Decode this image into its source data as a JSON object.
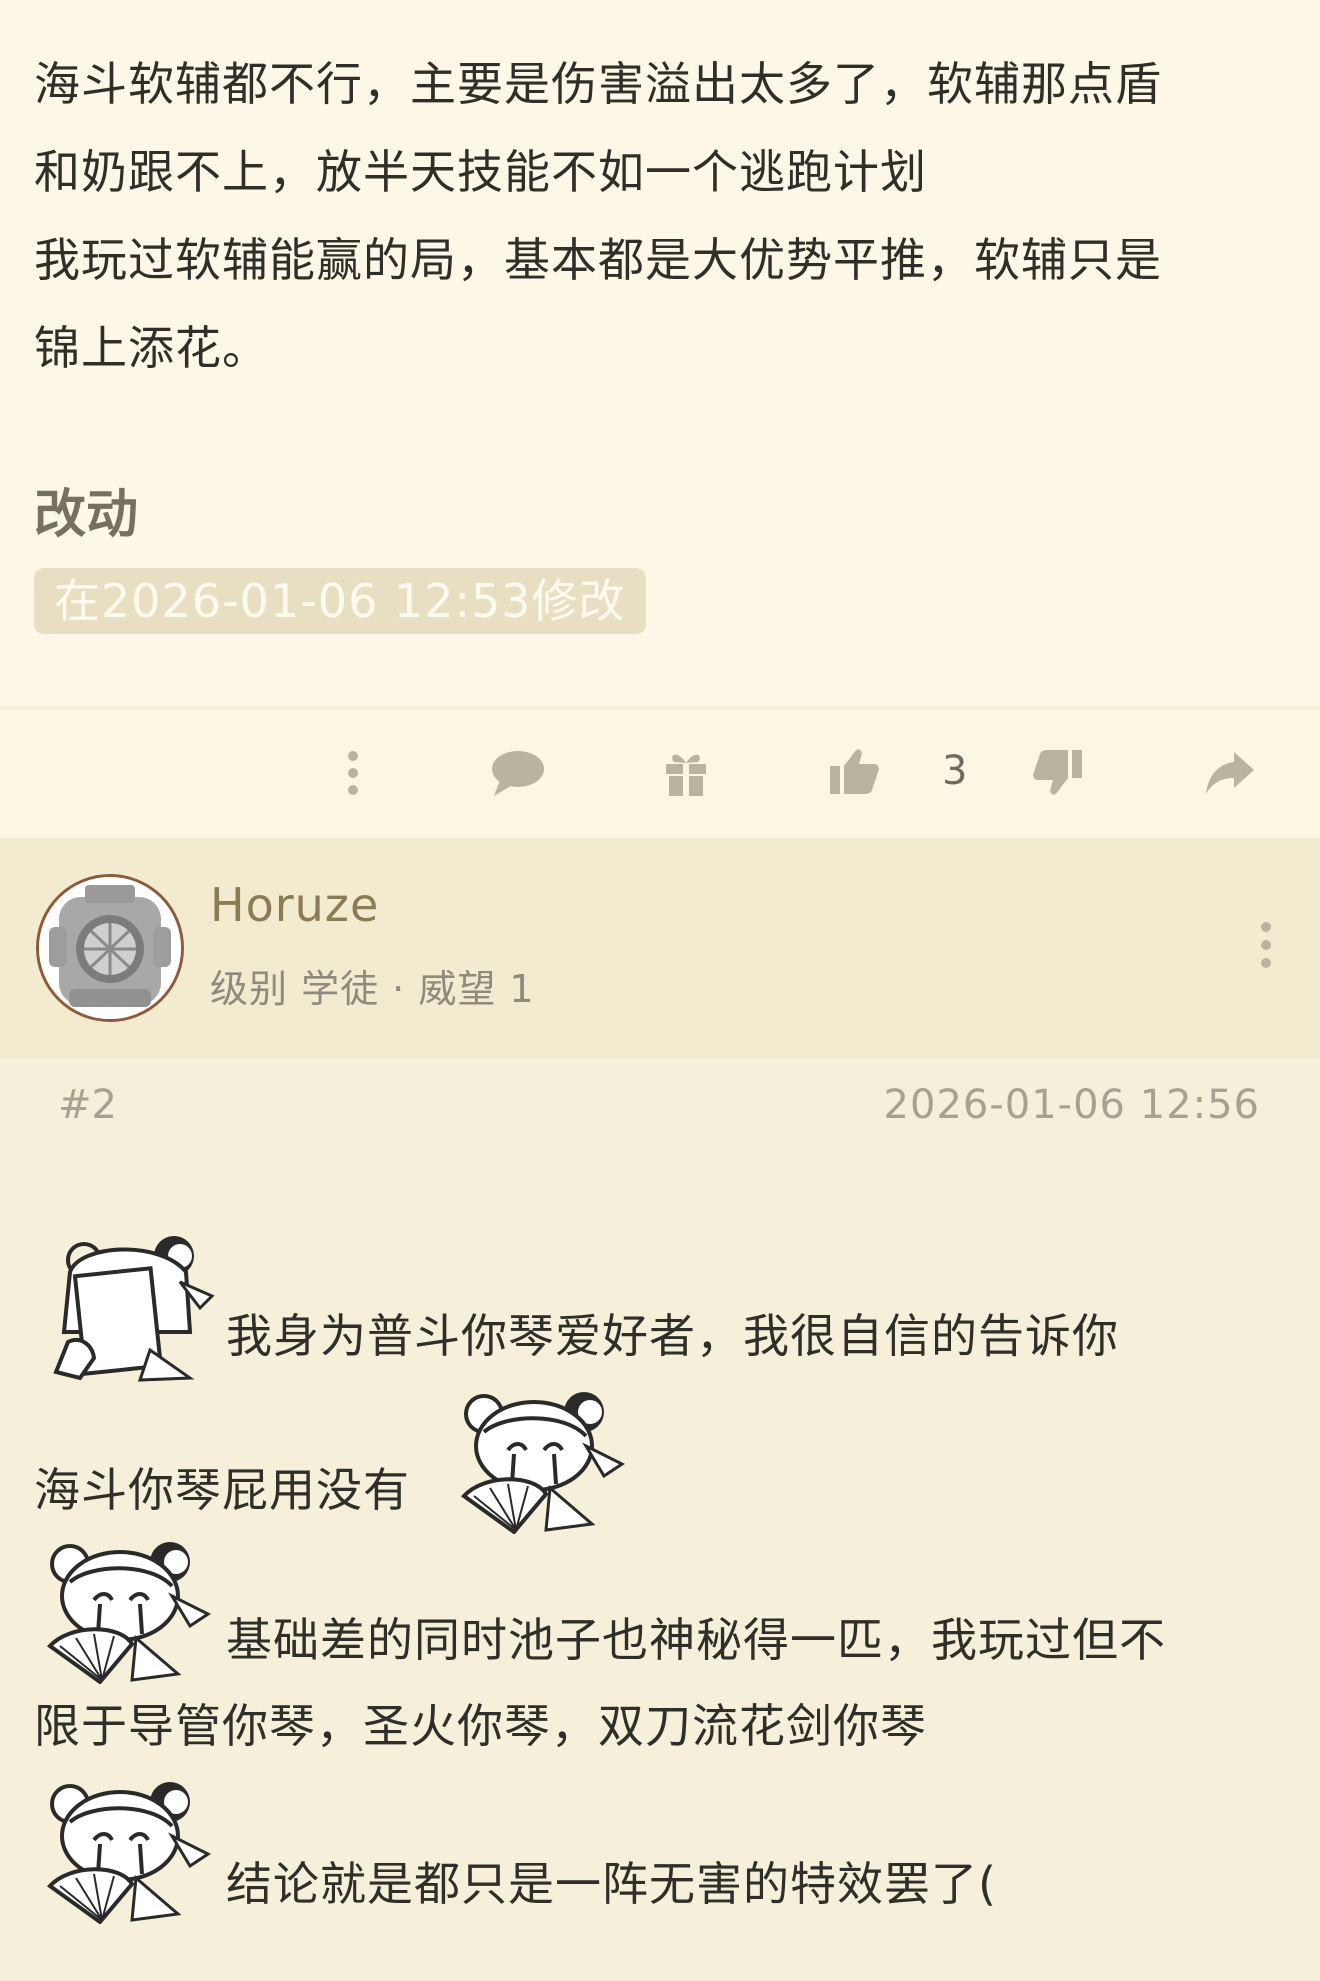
{
  "post": {
    "paragraphs": [
      "海斗软辅都不行，主要是伤害溢出太多了，软辅那点盾",
      "和奶跟不上，放半天技能不如一个逃跑计划",
      "我玩过软辅能赢的局，基本都是大优势平推，软辅只是",
      "锦上添花。"
    ],
    "edit_heading": "改动",
    "edit_badge": "在2026-01-06 12:53修改"
  },
  "action_bar": {
    "icons": [
      "more-vertical-icon",
      "comment-icon",
      "gift-icon",
      "thumbs-up-icon",
      "thumbs-down-icon",
      "share-icon"
    ],
    "like_count": "3"
  },
  "reply": {
    "user": {
      "name": "Horuze",
      "meta": "级别 学徒 · 威望 1"
    },
    "floor": "#2",
    "timestamp": "2026-01-06 12:56",
    "lines": [
      "我身为普斗你琴爱好者，我很自信的告诉你",
      "海斗你琴屁用没有",
      "基础差的同时池子也神秘得一匹，我玩过但不",
      "限于导管你琴，圣火你琴，双刀流花剑你琴",
      "结论就是都只是一阵无害的特效罢了("
    ],
    "stickers": [
      "sticker-covering-face",
      "sticker-crying-fan",
      "sticker-crying-fan",
      "sticker-crying-fan"
    ]
  },
  "colors": {
    "page_bg": "#f6f0da",
    "post_bg": "#fcf7e6",
    "icon": "#b9b3a0",
    "username": "#8a7c55",
    "meta": "#8e8a7c"
  }
}
